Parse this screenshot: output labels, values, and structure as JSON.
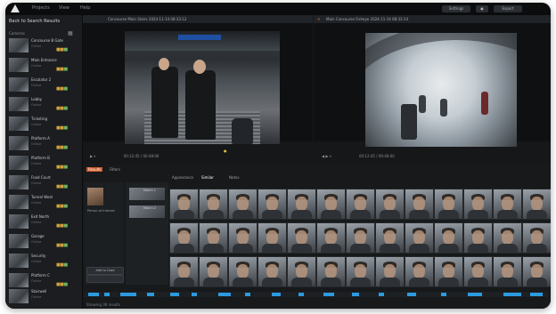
{
  "titlebar": {
    "menu": [
      "Projects",
      "View",
      "Help"
    ],
    "buttons": [
      "Settings",
      "Export"
    ]
  },
  "sidebar": {
    "title": "Back to Search Results",
    "subtitle": "Cameras",
    "footer": "",
    "items": [
      {
        "name": "Concourse B Gate",
        "status": "Online"
      },
      {
        "name": "Main Entrance",
        "status": "Online"
      },
      {
        "name": "Escalator 2",
        "status": "Online"
      },
      {
        "name": "Lobby",
        "status": "Online"
      },
      {
        "name": "Ticketing",
        "status": "Online"
      },
      {
        "name": "Platform A",
        "status": "Online"
      },
      {
        "name": "Platform B",
        "status": "Online"
      },
      {
        "name": "Food Court",
        "status": "Online"
      },
      {
        "name": "Tunnel West",
        "status": "Online"
      },
      {
        "name": "Exit North",
        "status": "Online"
      },
      {
        "name": "Garage",
        "status": "Online"
      },
      {
        "name": "Security",
        "status": "Online"
      },
      {
        "name": "Platform C",
        "status": "Online"
      },
      {
        "name": "Stairwell",
        "status": "Online"
      }
    ]
  },
  "video_left": {
    "tab": "Concourse Main Stairs 2024-11-14 08:33:12",
    "controls": "00:12:45 / 00:48:00"
  },
  "video_right": {
    "tab": "Main Concourse Fisheye 2024-11-14 08:33:14",
    "controls": "00:12:45 / 00:48:00"
  },
  "lower": {
    "tabs": [
      "Results",
      "Filters",
      "Appearance",
      "Similar",
      "Notes"
    ],
    "active_tab": "Similar",
    "left_label": "Person of Interest",
    "mid_rows": [
      "Match 1",
      "Match 2"
    ],
    "button": "Add to Case",
    "footer": "Showing 36 results"
  },
  "colors": {
    "accent": "#2b9be0",
    "warn": "#d3a13b",
    "ok": "#6fb55a",
    "bg": "#151719"
  }
}
